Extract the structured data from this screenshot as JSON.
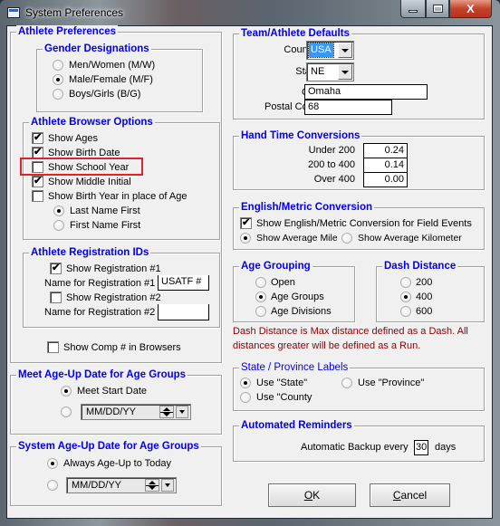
{
  "window": {
    "title": "System Preferences",
    "caption_buttons": [
      "minimize",
      "maximize",
      "close"
    ],
    "close_glyph": "X"
  },
  "athlete_preferences": {
    "legend": "Athlete Preferences",
    "gender": {
      "legend": "Gender Designations",
      "options": [
        {
          "label": "Men/Women (M/W)",
          "selected": false
        },
        {
          "label": "Male/Female (M/F)",
          "selected": true
        },
        {
          "label": "Boys/Girls (B/G)",
          "selected": false
        }
      ]
    },
    "browser_options": {
      "legend": "Athlete Browser Options",
      "checks": [
        {
          "label": "Show Ages",
          "checked": true
        },
        {
          "label": "Show Birth Date",
          "checked": true
        },
        {
          "label": "Show School Year",
          "checked": false,
          "highlighted": true
        },
        {
          "label": "Show Middle Initial",
          "checked": true
        },
        {
          "label": "Show Birth Year in place of Age",
          "checked": false
        }
      ],
      "name_order": [
        {
          "label": "Last Name First",
          "selected": true
        },
        {
          "label": "First Name First",
          "selected": false
        }
      ]
    },
    "registration": {
      "legend": "Athlete Registration IDs",
      "show_reg1": {
        "label": "Show Registration #1",
        "checked": true
      },
      "name_reg1": {
        "label": "Name for Registration #1",
        "value": "USATF #"
      },
      "show_reg2": {
        "label": "Show Registration #2",
        "checked": false
      },
      "name_reg2": {
        "label": "Name for Registration #2",
        "value": ""
      }
    },
    "show_comp": {
      "label": "Show Comp # in Browsers",
      "checked": false
    }
  },
  "meet_ageup": {
    "legend": "Meet Age-Up Date for Age Groups",
    "option1": {
      "label": "Meet Start Date",
      "selected": true
    },
    "option2": {
      "selected": false,
      "date_placeholder": "MM/DD/YY"
    }
  },
  "system_ageup": {
    "legend": "System Age-Up Date for Age Groups",
    "option1": {
      "label": "Always Age-Up to Today",
      "selected": true
    },
    "option2": {
      "selected": false,
      "date_placeholder": "MM/DD/YY"
    }
  },
  "team_defaults": {
    "legend": "Team/Athlete Defaults",
    "country": {
      "label": "Country:",
      "value": "USA"
    },
    "state": {
      "label": "State:",
      "value": "NE"
    },
    "city": {
      "label": "City:",
      "value": "Omaha"
    },
    "postal": {
      "label": "Postal Code:",
      "value": "68"
    }
  },
  "hand_time": {
    "legend": "Hand Time Conversions",
    "rows": [
      {
        "label": "Under 200",
        "value": "0.24"
      },
      {
        "label": "200 to 400",
        "value": "0.14"
      },
      {
        "label": "Over 400",
        "value": "0.00"
      }
    ]
  },
  "english_metric": {
    "legend": "English/Metric Conversion",
    "show_conv": {
      "label": "Show English/Metric Conversion for Field Events",
      "checked": true
    },
    "avg_mile": {
      "label": "Show Average Mile",
      "selected": true
    },
    "avg_km": {
      "label": "Show Average Kilometer",
      "selected": false
    }
  },
  "age_grouping": {
    "legend": "Age Grouping",
    "options": [
      {
        "label": "Open",
        "selected": false
      },
      {
        "label": "Age Groups",
        "selected": true
      },
      {
        "label": "Age Divisions",
        "selected": false
      }
    ]
  },
  "dash_distance": {
    "legend": "Dash Distance",
    "options": [
      {
        "label": "200",
        "selected": false
      },
      {
        "label": "400",
        "selected": true
      },
      {
        "label": "600",
        "selected": false
      }
    ],
    "note": "Dash Distance is Max distance defined as a Dash.  All distances greater will be defined as a Run."
  },
  "state_labels": {
    "legend": "State / Province Labels",
    "options": [
      {
        "label": "Use \"State\"",
        "selected": true
      },
      {
        "label": "Use \"Province\"",
        "selected": false
      },
      {
        "label": "Use \"County",
        "selected": false
      }
    ]
  },
  "reminders": {
    "legend": "Automated Reminders",
    "prefix": "Automatic Backup every",
    "value": "30",
    "suffix": "days"
  },
  "buttons": {
    "ok": {
      "mnemonic": "O",
      "rest": "K"
    },
    "cancel": {
      "mnemonic": "C",
      "rest": "ancel"
    }
  },
  "colors": {
    "legend_blue": "#0000ee",
    "note_red": "#8b0000",
    "highlight_red": "#e0222a",
    "selection_blue": "#3399ff"
  }
}
